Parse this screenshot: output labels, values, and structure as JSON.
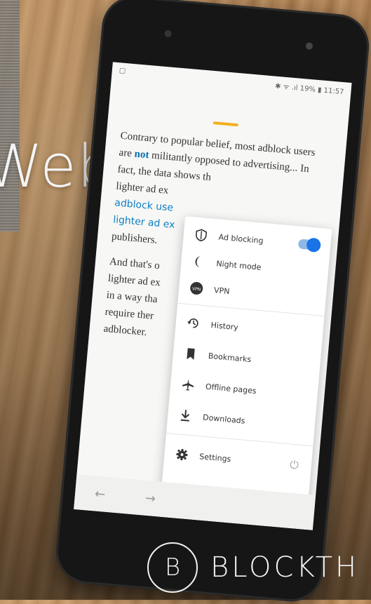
{
  "background": {
    "word": "Web"
  },
  "status_bar": {
    "left_icon": "screenshot-icon",
    "right_text": "✱ ᯤ .ıl 19% ▮ 11:57"
  },
  "article": {
    "p1_a": "Contrary to popular belief, most adblock users are ",
    "p1_hl": "not",
    "p1_b": " militantly opposed to advertising... In fact, the data shows th",
    "p1_c": "lighter ad ex",
    "p1_blue1": "adblock use",
    "p1_blue2": "lighter ad ex",
    "p1_d": "publishers.",
    "p2_a": "And that's o",
    "p2_b": "lighter ad ex",
    "p2_c": "in a way tha",
    "p2_d": "require ther",
    "p2_e": "adblocker."
  },
  "menu": {
    "items": [
      {
        "label": "Ad blocking",
        "icon": "shield-icon",
        "toggle": true
      },
      {
        "label": "Night mode",
        "icon": "moon-icon"
      },
      {
        "label": "VPN",
        "icon": "vpn-icon",
        "icon_text": "VPN"
      },
      {
        "label": "History",
        "icon": "history-icon"
      },
      {
        "label": "Bookmarks",
        "icon": "bookmark-icon"
      },
      {
        "label": "Offline pages",
        "icon": "airplane-icon"
      },
      {
        "label": "Downloads",
        "icon": "download-icon"
      },
      {
        "label": "Settings",
        "icon": "gear-icon"
      }
    ]
  },
  "nav": {
    "back": "←",
    "forward": "→",
    "power": "⏻"
  },
  "logo": {
    "mark": "B",
    "brand": "BLOCKTH"
  },
  "colors": {
    "accent": "#f2b01e",
    "link": "#0a7ec4",
    "toggle": "#1a73e8"
  }
}
